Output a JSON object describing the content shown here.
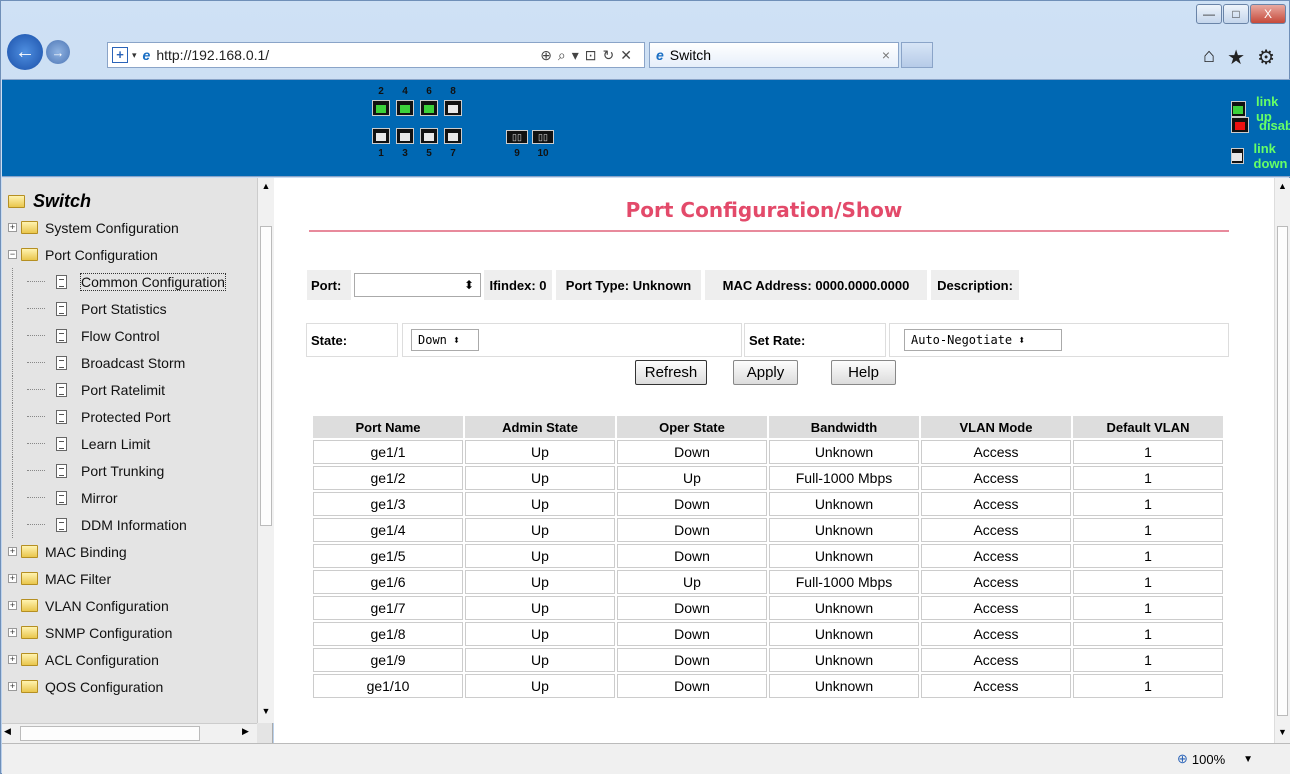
{
  "window": {
    "minimize": "—",
    "maximize": "□",
    "close": "X"
  },
  "browser": {
    "address": "http://192.168.0.1/",
    "tab_title": "Switch",
    "tab_close": "×"
  },
  "ports": {
    "top_numbers": [
      "2",
      "4",
      "6",
      "8"
    ],
    "bottom_numbers": [
      "1",
      "3",
      "5",
      "7"
    ],
    "sfp_numbers": [
      "9",
      "10"
    ]
  },
  "legend": {
    "up": "link up",
    "disable": "disable",
    "down": "link down"
  },
  "sidebar": {
    "root": "Switch",
    "items": [
      {
        "label": "System Configuration",
        "type": "folder"
      },
      {
        "label": "Port Configuration",
        "type": "folder-open"
      },
      {
        "label": "Common Configuration",
        "type": "doc"
      },
      {
        "label": "Port Statistics",
        "type": "doc"
      },
      {
        "label": "Flow Control",
        "type": "doc"
      },
      {
        "label": "Broadcast Storm",
        "type": "doc"
      },
      {
        "label": "Port Ratelimit",
        "type": "doc"
      },
      {
        "label": "Protected Port",
        "type": "doc"
      },
      {
        "label": "Learn Limit",
        "type": "doc"
      },
      {
        "label": "Port Trunking",
        "type": "doc"
      },
      {
        "label": "Mirror",
        "type": "doc"
      },
      {
        "label": "DDM Information",
        "type": "doc"
      },
      {
        "label": "MAC Binding",
        "type": "folder"
      },
      {
        "label": "MAC Filter",
        "type": "folder"
      },
      {
        "label": "VLAN Configuration",
        "type": "folder"
      },
      {
        "label": "SNMP Configuration",
        "type": "folder"
      },
      {
        "label": "ACL Configuration",
        "type": "folder"
      },
      {
        "label": "QOS Configuration",
        "type": "folder"
      }
    ]
  },
  "page": {
    "title": "Port Configuration/Show",
    "port_label": "Port:",
    "ifindex": "Ifindex: 0",
    "port_type": "Port Type: Unknown",
    "mac": "MAC Address: 0000.0000.0000",
    "description": "Description:",
    "state_label": "State:",
    "state_value": "Down",
    "rate_label": "Set Rate:",
    "rate_value": "Auto-Negotiate",
    "refresh": "Refresh",
    "apply": "Apply",
    "help": "Help"
  },
  "table": {
    "headers": [
      "Port Name",
      "Admin State",
      "Oper State",
      "Bandwidth",
      "VLAN Mode",
      "Default VLAN"
    ],
    "rows": [
      [
        "ge1/1",
        "Up",
        "Down",
        "Unknown",
        "Access",
        "1"
      ],
      [
        "ge1/2",
        "Up",
        "Up",
        "Full-1000 Mbps",
        "Access",
        "1"
      ],
      [
        "ge1/3",
        "Up",
        "Down",
        "Unknown",
        "Access",
        "1"
      ],
      [
        "ge1/4",
        "Up",
        "Down",
        "Unknown",
        "Access",
        "1"
      ],
      [
        "ge1/5",
        "Up",
        "Down",
        "Unknown",
        "Access",
        "1"
      ],
      [
        "ge1/6",
        "Up",
        "Up",
        "Full-1000 Mbps",
        "Access",
        "1"
      ],
      [
        "ge1/7",
        "Up",
        "Down",
        "Unknown",
        "Access",
        "1"
      ],
      [
        "ge1/8",
        "Up",
        "Down",
        "Unknown",
        "Access",
        "1"
      ],
      [
        "ge1/9",
        "Up",
        "Down",
        "Unknown",
        "Access",
        "1"
      ],
      [
        "ge1/10",
        "Up",
        "Down",
        "Unknown",
        "Access",
        "1"
      ]
    ]
  },
  "status": {
    "zoom": "100%"
  },
  "colors": {
    "banner": "#0068b3",
    "title": "#e34a6a",
    "legend_text": "#66ff66"
  }
}
